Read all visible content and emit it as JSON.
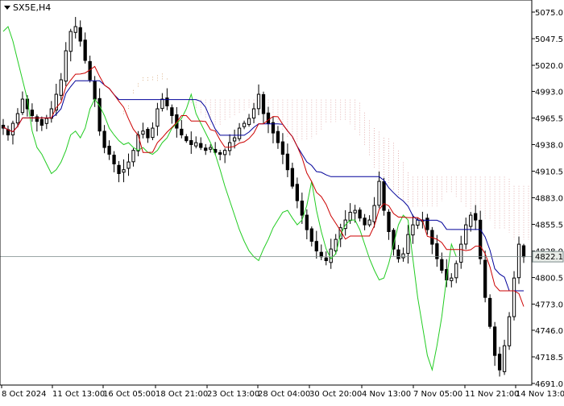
{
  "chart_data": {
    "type": "candlestick",
    "symbol": "SX5E,H4",
    "current_price": 4822.1,
    "current_price_label": "4822.1",
    "ylim": [
      4691.0,
      5075.0
    ],
    "y_ticks": [
      "5075.0",
      "5047.5",
      "5020.0",
      "4993.0",
      "4965.5",
      "4938.0",
      "4910.5",
      "4883.0",
      "4855.5",
      "4828.0",
      "4800.5",
      "4773.0",
      "4746.0",
      "4718.5",
      "4691.0"
    ],
    "x_ticks": [
      "8 Oct 2024",
      "11 Oct 13:00",
      "16 Oct 05:00",
      "18 Oct 21:00",
      "23 Oct 13:00",
      "28 Oct 04:00",
      "30 Oct 20:00",
      "4 Nov 13:00",
      "7 Nov 05:00",
      "11 Nov 21:00",
      "14 Nov 13:00"
    ],
    "grid": false,
    "colors": {
      "candle": "#000000",
      "background": "#ffffff",
      "tenkan": "#cc0000",
      "kijun": "#000099",
      "chikou": "#22cc22",
      "cloud_a": "#d2a06e",
      "cloud_b": "#dca0a0",
      "price_line": "#7a8a8a"
    },
    "closes": [
      4955,
      4948,
      4960,
      4970,
      4985,
      4975,
      4968,
      4962,
      4958,
      4965,
      4975,
      4990,
      5005,
      5035,
      5055,
      5060,
      5045,
      5025,
      5005,
      4985,
      4952,
      4935,
      4928,
      4918,
      4908,
      4912,
      4920,
      4932,
      4948,
      4952,
      4945,
      4955,
      4975,
      4985,
      4978,
      4968,
      4955,
      4948,
      4942,
      4938,
      4940,
      4935,
      4932,
      4935,
      4930,
      4928,
      4932,
      4940,
      4945,
      4955,
      4960,
      4965,
      4975,
      4990,
      4970,
      4960,
      4950,
      4940,
      4928,
      4912,
      4895,
      4880,
      4865,
      4850,
      4838,
      4828,
      4822,
      4818,
      4830,
      4840,
      4852,
      4860,
      4868,
      4870,
      4862,
      4855,
      4860,
      4875,
      4900,
      4870,
      4848,
      4830,
      4820,
      4825,
      4845,
      4855,
      4860,
      4860,
      4850,
      4835,
      4820,
      4808,
      4798,
      4800,
      4815,
      4835,
      4855,
      4865,
      4860,
      4820,
      4780,
      4750,
      4720,
      4705,
      4730,
      4760,
      4800,
      4835,
      4822
    ]
  }
}
